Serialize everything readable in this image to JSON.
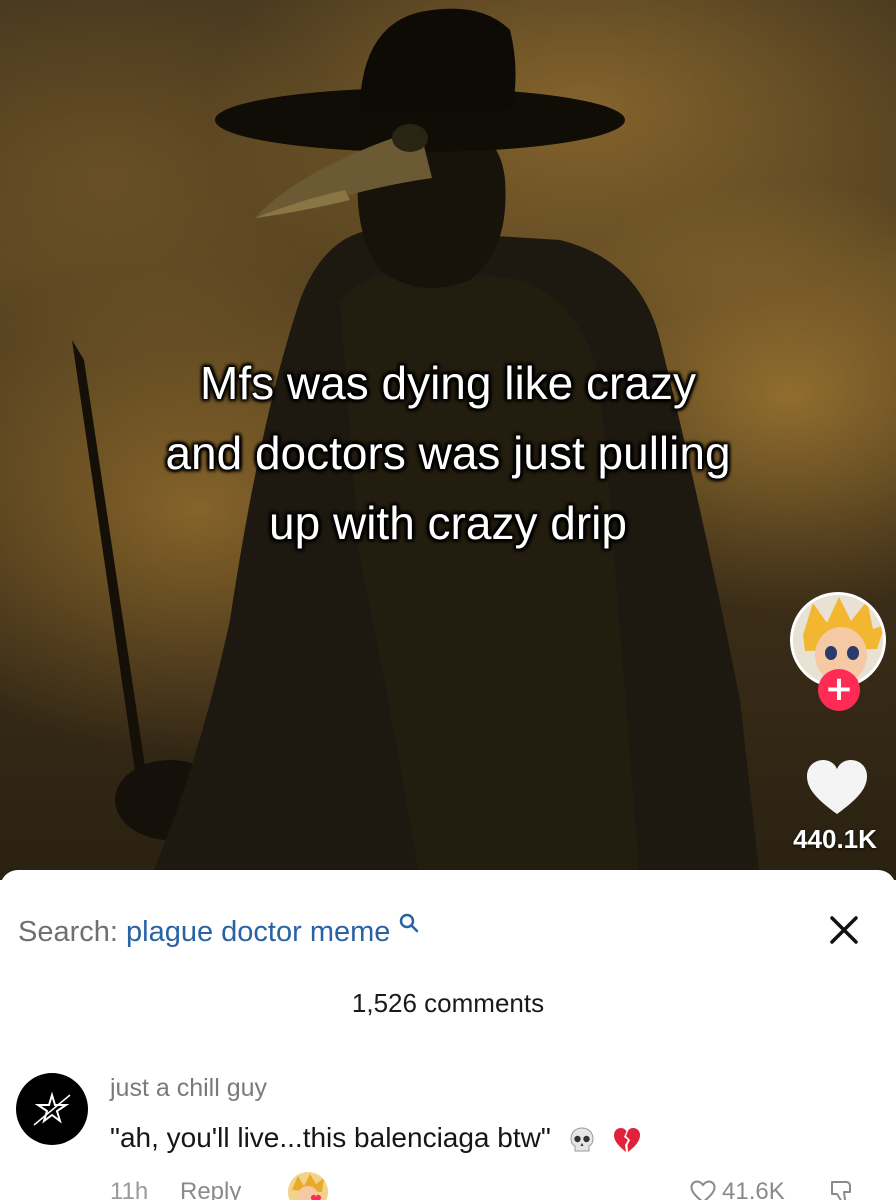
{
  "video": {
    "caption_lines": [
      "Mfs was dying like crazy",
      "and doctors was just pulling",
      "up with crazy drip"
    ],
    "follow_symbol": "+",
    "like_count": "440.1K"
  },
  "comments_panel": {
    "search_label": "Search:",
    "search_term": "plague doctor meme",
    "comment_count": "1,526 comments",
    "comment": {
      "username": "just a chill guy",
      "text": "\"ah, you'll live...this balenciaga btw\"",
      "emojis": [
        "skull-emoji",
        "broken-heart-emoji"
      ],
      "time": "11h",
      "reply_label": "Reply",
      "like_count": "41.6K"
    }
  },
  "colors": {
    "follow_button": "#fe2c55",
    "search_link": "#2a62a6",
    "broken_heart": "#e0223a"
  }
}
